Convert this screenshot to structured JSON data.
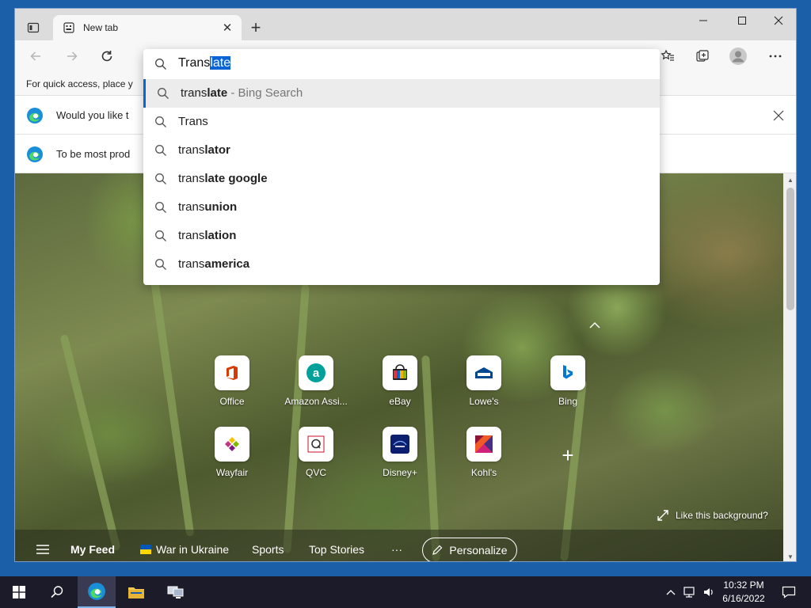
{
  "browser": {
    "tab": {
      "title": "New tab"
    },
    "favorites_bar_text": "For quick access, place y",
    "infobar_1": "Would you like t",
    "infobar_2": "To be most prod"
  },
  "address_dropdown": {
    "typed_plain": "Trans",
    "typed_selected": "late",
    "suggestions": [
      {
        "plain": "trans",
        "bold": "late",
        "suffix": " - Bing Search",
        "active": true
      },
      {
        "plain": "Trans",
        "bold": "",
        "suffix": ""
      },
      {
        "plain": "trans",
        "bold": "lator",
        "suffix": ""
      },
      {
        "plain": "trans",
        "bold": "late google",
        "suffix": ""
      },
      {
        "plain": "trans",
        "bold": "union",
        "suffix": ""
      },
      {
        "plain": "trans",
        "bold": "lation",
        "suffix": ""
      },
      {
        "plain": "trans",
        "bold": "america",
        "suffix": ""
      }
    ]
  },
  "quick_links": [
    {
      "label": "Office",
      "icon": "office-icon",
      "color": "#d83b01"
    },
    {
      "label": "Amazon Assi...",
      "icon": "amazon-icon",
      "color": "#00a19b"
    },
    {
      "label": "eBay",
      "icon": "ebay-icon",
      "color": "#e53238"
    },
    {
      "label": "Lowe's",
      "icon": "lowes-icon",
      "color": "#004990"
    },
    {
      "label": "Bing",
      "icon": "bing-icon",
      "color": "#0078d4"
    },
    {
      "label": "Wayfair",
      "icon": "wayfair-icon",
      "color": "#7f187f"
    },
    {
      "label": "QVC",
      "icon": "qvc-icon",
      "color": "#333333"
    },
    {
      "label": "Disney+",
      "icon": "disney-icon",
      "color": "#113ccf"
    },
    {
      "label": "Kohl's",
      "icon": "kohls-icon",
      "color": "#8a1538"
    }
  ],
  "like_background": "Like this background?",
  "feed": {
    "my_feed": "My Feed",
    "war": "War in Ukraine",
    "sports": "Sports",
    "top_stories": "Top Stories",
    "more": "···",
    "personalize": "Personalize"
  },
  "taskbar": {
    "time": "10:32 PM",
    "date": "6/16/2022"
  }
}
